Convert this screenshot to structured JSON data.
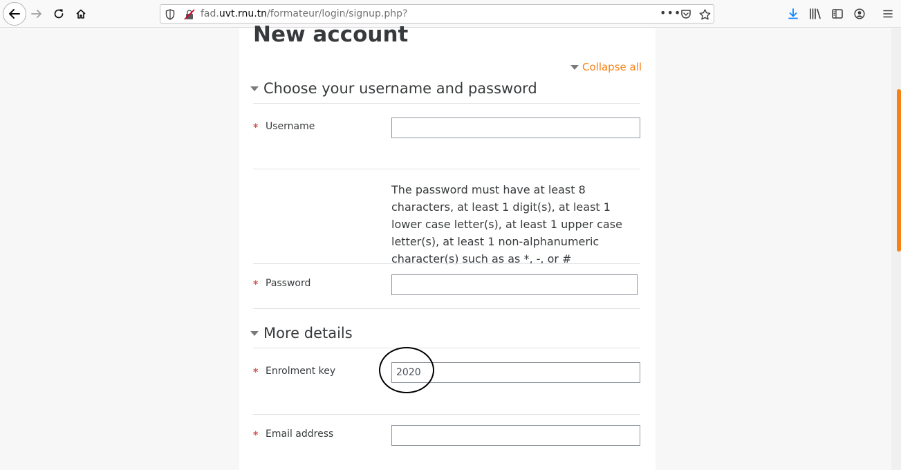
{
  "browser": {
    "url_prefix": "fad.",
    "url_host": "uvt.rnu.tn",
    "url_path": "/formateur/login/signup.php?",
    "url_more": "•••"
  },
  "page": {
    "title": "New account",
    "collapse_all": "Collapse all"
  },
  "sections": {
    "credentials": {
      "title": "Choose your username and password"
    },
    "details": {
      "title": "More details"
    }
  },
  "fields": {
    "required_mark": "*",
    "username": {
      "label": "Username",
      "value": ""
    },
    "password_rules": "The password must have at least 8 characters, at least 1 digit(s), at least 1 lower case letter(s), at least 1 upper case letter(s), at least 1 non-alphanumeric character(s) such as as *, -, or #",
    "password": {
      "label": "Password",
      "value": ""
    },
    "enrolment_key": {
      "label": "Enrolment key",
      "value": "2020"
    },
    "email": {
      "label": "Email address",
      "value": ""
    }
  },
  "colors": {
    "accent": "#f98012",
    "required": "#d9534f",
    "download": "#0a84ff"
  }
}
